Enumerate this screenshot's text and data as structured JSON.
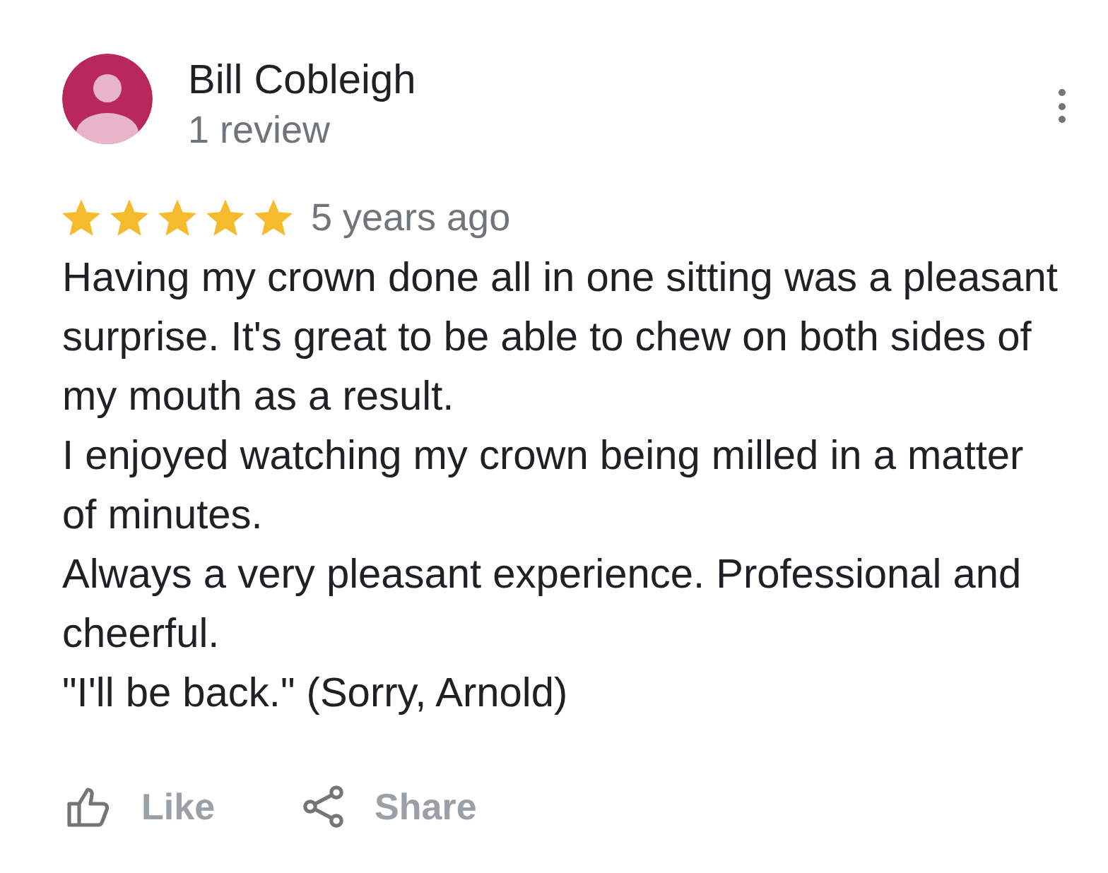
{
  "reviewer": {
    "name": "Bill Cobleigh",
    "review_count": "1 review"
  },
  "review": {
    "stars": 5,
    "time": "5 years ago",
    "paragraphs": [
      "Having my crown done all in one sitting was a pleasant surprise. It's great to be able to chew on both sides of my mouth as a result.",
      "I enjoyed watching my crown being milled in a matter of minutes.",
      "Always a very pleasant experience. Professional and cheerful.",
      "\"I'll be back.\" (Sorry, Arnold)"
    ]
  },
  "actions": [
    {
      "kind": "like",
      "label": "Like"
    },
    {
      "kind": "share",
      "label": "Share"
    }
  ]
}
